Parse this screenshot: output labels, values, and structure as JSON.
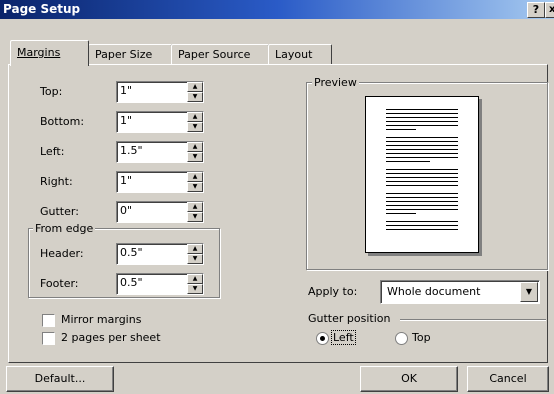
{
  "title": "Page Setup",
  "titlebar": {
    "help": "?",
    "close": "x"
  },
  "tabs": [
    "Margins",
    "Paper Size",
    "Paper Source",
    "Layout"
  ],
  "margins": {
    "top": {
      "label": "Top:",
      "value": "1\""
    },
    "bottom": {
      "label": "Bottom:",
      "value": "1\""
    },
    "left": {
      "label": "Left:",
      "value": "1.5\""
    },
    "right": {
      "label": "Right:",
      "value": "1\""
    },
    "gutter": {
      "label": "Gutter:",
      "value": "0\""
    }
  },
  "from_edge": {
    "title": "From edge",
    "header": {
      "label": "Header:",
      "value": "0.5\""
    },
    "footer": {
      "label": "Footer:",
      "value": "0.5\""
    }
  },
  "preview": {
    "title": "Preview"
  },
  "apply_to": {
    "label": "Apply to:",
    "value": "Whole document"
  },
  "gutter_position": {
    "title": "Gutter position",
    "left": "Left",
    "top": "Top",
    "selected": "Left"
  },
  "checkboxes": {
    "mirror": "Mirror margins",
    "two_pages": "2 pages per sheet"
  },
  "buttons": {
    "default": "Default...",
    "ok": "OK",
    "cancel": "Cancel"
  }
}
